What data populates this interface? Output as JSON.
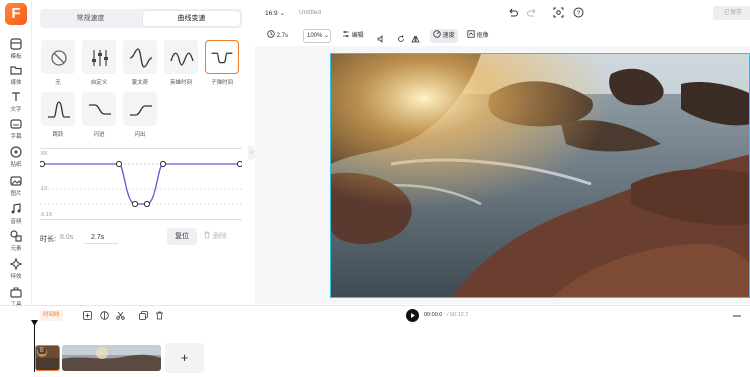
{
  "app": {
    "logo": "F"
  },
  "rail": {
    "items": [
      {
        "label": "模板",
        "icon": "template-icon"
      },
      {
        "label": "媒体",
        "icon": "folder-icon"
      },
      {
        "label": "文字",
        "icon": "text-icon"
      },
      {
        "label": "字幕",
        "icon": "subtitle-icon"
      },
      {
        "label": "贴纸",
        "icon": "sticker-icon"
      },
      {
        "label": "图片",
        "icon": "image-icon"
      },
      {
        "label": "音频",
        "icon": "music-icon"
      },
      {
        "label": "元素",
        "icon": "shapes-icon"
      },
      {
        "label": "特效",
        "icon": "effects-icon"
      },
      {
        "label": "工具",
        "icon": "toolbox-icon"
      }
    ]
  },
  "panel": {
    "tabs": [
      {
        "label": "常规速度"
      },
      {
        "label": "曲线变速"
      }
    ],
    "active_tab": 1,
    "presets": [
      {
        "label": "无",
        "icon": "none-icon"
      },
      {
        "label": "自定义",
        "icon": "sliders-icon"
      },
      {
        "label": "蒙太奇",
        "icon": "curve-montage-icon"
      },
      {
        "label": "英雄时刻",
        "icon": "curve-hero-icon"
      },
      {
        "label": "子弹时间",
        "icon": "curve-bullet-icon"
      },
      {
        "label": "跳跃",
        "icon": "curve-jump-icon"
      },
      {
        "label": "闪进",
        "icon": "curve-flash-in-icon"
      },
      {
        "label": "闪出",
        "icon": "curve-flash-out-icon"
      }
    ],
    "selected_preset": 4,
    "graph": {
      "max_label": "8X",
      "mid_label": "1X",
      "min_label": "0.1X"
    },
    "duration": {
      "label": "时长:",
      "from": "8.0s",
      "to": "2.7s"
    },
    "reset_label": "复位",
    "delete_label": "删除"
  },
  "topbar": {
    "ratio": "16:9",
    "title": "Untitled",
    "export_label": "已保存"
  },
  "toolbar": {
    "duration": "2.7s",
    "zoom": "100%",
    "edit_label": "编辑",
    "speed_label": "速度",
    "keyframe_label": "抠像"
  },
  "timeline": {
    "speed_badge": "时间线",
    "current_time": "00:00.0",
    "total_time": "/ 00:12.7",
    "clip_badge": "0:"
  },
  "colors": {
    "accent": "#f07a2a",
    "selection": "#33c3e0",
    "curve": "#5a5ad8"
  }
}
